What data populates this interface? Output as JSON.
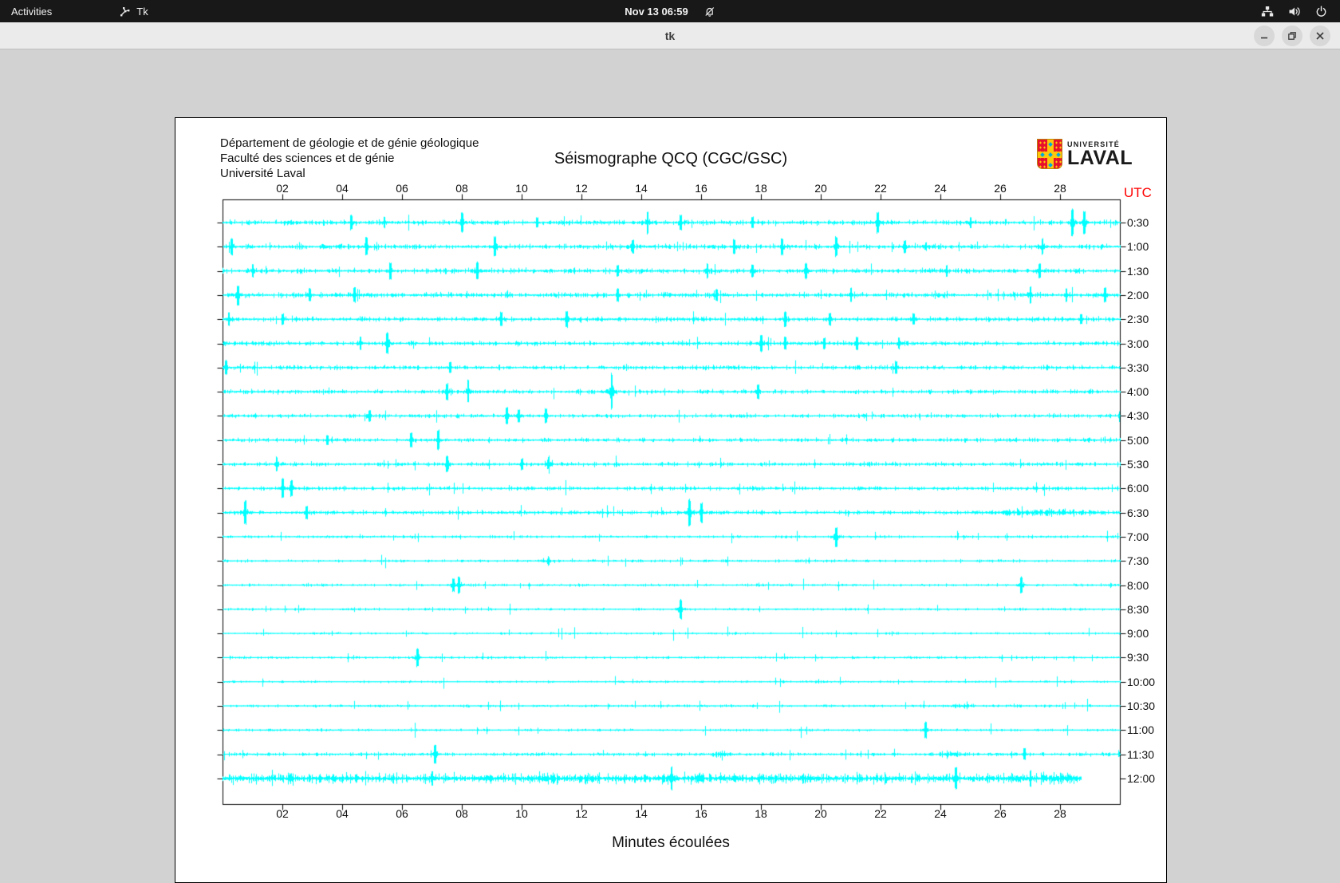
{
  "top_bar": {
    "activities_label": "Activities",
    "app_menu_label": "Tk",
    "clock": "Nov 13  06:59",
    "status_icons": [
      "network-icon",
      "volume-icon",
      "power-icon"
    ]
  },
  "window": {
    "title": "tk",
    "controls": {
      "minimize": "minimize",
      "maximize": "maximize",
      "close": "close"
    }
  },
  "document": {
    "header_lines": [
      "Département de géologie et de génie géologique",
      "Faculté des sciences et de génie",
      "Université Laval"
    ],
    "title": "Séismographe QCQ (CGC/GSC)",
    "utc_label": "UTC",
    "xlabel": "Minutes écoulées",
    "logo": {
      "institution_small": "UNIVERSITÉ",
      "institution_large": "LAVAL",
      "shield_red": "#e8112d",
      "shield_gold": "#ffc60b",
      "shield_blue": "#00a9e0"
    }
  },
  "chart_data": {
    "type": "line",
    "subtype": "seismogram-helicorder",
    "title": "Séismographe QCQ (CGC/GSC)",
    "xlabel": "Minutes écoulées",
    "xlim": [
      0,
      30
    ],
    "x_tick_labels": [
      "02",
      "04",
      "06",
      "08",
      "10",
      "12",
      "14",
      "16",
      "18",
      "20",
      "22",
      "24",
      "26",
      "28"
    ],
    "trace_color": "#00ffff",
    "axis_color": "#000000",
    "utc_label_color": "#ff0000",
    "row_labels": [
      "0:30",
      "1:00",
      "1:30",
      "2:00",
      "2:30",
      "3:00",
      "3:30",
      "4:00",
      "4:30",
      "5:00",
      "5:30",
      "6:00",
      "6:30",
      "7:00",
      "7:30",
      "8:00",
      "8:30",
      "9:00",
      "9:30",
      "10:00",
      "10:30",
      "11:00",
      "11:30",
      "12:00"
    ],
    "rows": [
      {
        "label": "0:30",
        "noise": 1.1,
        "events": [
          [
            4.3,
            9,
            0
          ],
          [
            5.4,
            7,
            0
          ],
          [
            8.0,
            12,
            0
          ],
          [
            10.5,
            6,
            0
          ],
          [
            14.2,
            14,
            0
          ],
          [
            15.3,
            9,
            0
          ],
          [
            17.7,
            7,
            0
          ],
          [
            21.9,
            13,
            0
          ],
          [
            25.0,
            7,
            0
          ],
          [
            28.4,
            16,
            0
          ],
          [
            28.8,
            14,
            0
          ]
        ]
      },
      {
        "label": "1:00",
        "noise": 1.1,
        "events": [
          [
            0.3,
            10,
            0
          ],
          [
            4.8,
            11,
            0
          ],
          [
            9.1,
            12,
            0
          ],
          [
            13.7,
            8,
            0
          ],
          [
            17.1,
            9,
            0
          ],
          [
            18.7,
            10,
            0
          ],
          [
            20.5,
            12,
            0
          ],
          [
            22.8,
            8,
            0
          ],
          [
            23.5,
            6,
            0.4
          ],
          [
            27.4,
            10,
            0
          ]
        ]
      },
      {
        "label": "1:30",
        "noise": 1.1,
        "events": [
          [
            1.0,
            8,
            0
          ],
          [
            5.6,
            10,
            0
          ],
          [
            8.5,
            11,
            0
          ],
          [
            13.2,
            7,
            0
          ],
          [
            16.2,
            9,
            0
          ],
          [
            17.7,
            8,
            0
          ],
          [
            19.5,
            10,
            0
          ],
          [
            24.2,
            7,
            0
          ],
          [
            27.3,
            9,
            0
          ]
        ]
      },
      {
        "label": "2:00",
        "noise": 1.1,
        "events": [
          [
            0.5,
            12,
            0
          ],
          [
            2.9,
            8,
            0
          ],
          [
            4.4,
            9,
            0
          ],
          [
            13.2,
            8,
            0
          ],
          [
            16.5,
            7,
            0
          ],
          [
            21.0,
            9,
            0
          ],
          [
            24.0,
            7,
            0.5
          ],
          [
            27.0,
            10,
            0
          ],
          [
            28.2,
            8,
            0
          ],
          [
            29.5,
            9,
            0
          ]
        ]
      },
      {
        "label": "2:30",
        "noise": 1.0,
        "events": [
          [
            0.2,
            8,
            0
          ],
          [
            2.0,
            7,
            0
          ],
          [
            9.3,
            9,
            0
          ],
          [
            11.5,
            10,
            0
          ],
          [
            18.8,
            9,
            0
          ],
          [
            20.3,
            8,
            0
          ],
          [
            23.1,
            7,
            0
          ],
          [
            28.7,
            6,
            0
          ]
        ]
      },
      {
        "label": "3:00",
        "noise": 1.0,
        "events": [
          [
            4.6,
            8,
            0
          ],
          [
            5.5,
            13,
            0
          ],
          [
            18.0,
            10,
            0
          ],
          [
            18.8,
            8,
            0
          ],
          [
            20.1,
            7,
            0
          ],
          [
            21.2,
            8,
            0
          ],
          [
            22.6,
            7,
            0
          ]
        ]
      },
      {
        "label": "3:30",
        "noise": 0.95,
        "events": [
          [
            0.1,
            9,
            0
          ],
          [
            7.6,
            7,
            0
          ],
          [
            22.5,
            8,
            0
          ]
        ]
      },
      {
        "label": "4:00",
        "noise": 0.95,
        "events": [
          [
            7.5,
            10,
            0
          ],
          [
            8.2,
            14,
            0
          ],
          [
            13.0,
            22,
            0
          ],
          [
            17.9,
            9,
            0
          ]
        ]
      },
      {
        "label": "4:30",
        "noise": 0.9,
        "events": [
          [
            4.9,
            7,
            0
          ],
          [
            9.5,
            10,
            0
          ],
          [
            9.9,
            8,
            0
          ],
          [
            10.8,
            9,
            0
          ]
        ]
      },
      {
        "label": "5:00",
        "noise": 0.9,
        "events": [
          [
            3.5,
            6,
            0
          ],
          [
            6.3,
            9,
            0
          ],
          [
            7.2,
            12,
            0
          ],
          [
            23.0,
            5,
            0.4
          ]
        ]
      },
      {
        "label": "5:30",
        "noise": 0.9,
        "events": [
          [
            1.8,
            9,
            0
          ],
          [
            7.5,
            10,
            0
          ],
          [
            10.0,
            7,
            0
          ],
          [
            10.9,
            12,
            0.3
          ]
        ]
      },
      {
        "label": "6:00",
        "noise": 0.85,
        "events": [
          [
            2.0,
            12,
            0
          ],
          [
            2.3,
            10,
            0
          ]
        ]
      },
      {
        "label": "6:30",
        "noise": 0.9,
        "events": [
          [
            0.75,
            14,
            0
          ],
          [
            2.8,
            8,
            0
          ],
          [
            15.6,
            16,
            0
          ],
          [
            16.0,
            12,
            0
          ],
          [
            27.5,
            6,
            5
          ]
        ]
      },
      {
        "label": "7:00",
        "noise": 0.6,
        "events": [
          [
            20.5,
            12,
            0
          ]
        ]
      },
      {
        "label": "7:30",
        "noise": 0.6,
        "events": [
          [
            10.8,
            6,
            0.6
          ]
        ]
      },
      {
        "label": "8:00",
        "noise": 0.6,
        "events": [
          [
            7.7,
            8,
            0
          ],
          [
            7.9,
            10,
            0
          ],
          [
            26.7,
            10,
            0
          ]
        ]
      },
      {
        "label": "8:30",
        "noise": 0.55,
        "events": [
          [
            15.3,
            12,
            0
          ]
        ]
      },
      {
        "label": "9:00",
        "noise": 0.5,
        "events": []
      },
      {
        "label": "9:30",
        "noise": 0.55,
        "events": [
          [
            6.5,
            11,
            0
          ]
        ]
      },
      {
        "label": "10:00",
        "noise": 0.5,
        "events": []
      },
      {
        "label": "10:30",
        "noise": 0.55,
        "events": [
          [
            24.7,
            5,
            0.8
          ]
        ]
      },
      {
        "label": "11:00",
        "noise": 0.55,
        "events": [
          [
            23.5,
            10,
            0
          ]
        ]
      },
      {
        "label": "11:30",
        "noise": 0.8,
        "events": [
          [
            7.1,
            11,
            0
          ],
          [
            16.6,
            5,
            0.8
          ],
          [
            24.3,
            6,
            0.8
          ],
          [
            26.8,
            7,
            0
          ]
        ]
      },
      {
        "label": "12:00",
        "noise": 2.1,
        "end": 28.7,
        "events": [
          [
            7.0,
            9,
            0
          ],
          [
            9.0,
            6,
            1
          ],
          [
            10.8,
            10,
            1.5
          ],
          [
            12.2,
            8,
            0.8
          ],
          [
            15.0,
            14,
            0
          ],
          [
            16.0,
            7,
            1
          ],
          [
            18.5,
            7,
            1
          ],
          [
            19.5,
            8,
            1
          ],
          [
            24.5,
            13,
            0
          ],
          [
            25.5,
            6,
            1
          ],
          [
            26.5,
            8,
            1
          ],
          [
            27.0,
            10,
            0
          ],
          [
            27.9,
            9,
            1
          ],
          [
            28.5,
            8,
            0.6
          ]
        ]
      }
    ]
  }
}
